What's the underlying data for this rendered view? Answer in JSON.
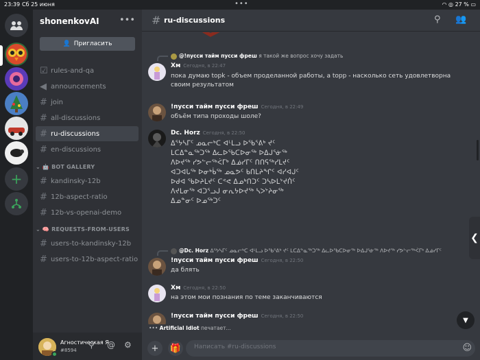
{
  "statusbar": {
    "time": "23:39",
    "date": "Сб 25 июня",
    "battery": "27 %"
  },
  "servers": [
    "Home",
    "Server 1",
    "Server 2",
    "Server 3",
    "Server 4",
    "Server 5"
  ],
  "sidebar": {
    "guild_name": "shonenkovAI",
    "invite_label": "Пригласить",
    "channels": [
      {
        "name": "rules-and-qa",
        "icon": "checkbox-icon"
      },
      {
        "name": "announcements",
        "icon": "megaphone-icon"
      },
      {
        "name": "join",
        "icon": "hash-icon"
      },
      {
        "name": "all-discussions",
        "icon": "hash-icon"
      },
      {
        "name": "ru-discussions",
        "icon": "hash-icon"
      },
      {
        "name": "en-discussions",
        "icon": "hash-icon"
      }
    ],
    "categories": [
      {
        "label": "BOT GALLERY",
        "channels": [
          "kandinsky-12b",
          "12b-aspect-ratio",
          "12b-vs-openai-demo"
        ]
      },
      {
        "label": "REQUESTS-FROM-USERS",
        "channels": [
          "users-to-kandinsky-12b",
          "users-to-12b-aspect-ratio"
        ]
      }
    ]
  },
  "user": {
    "name": "Агностическая Я...",
    "tag": "#8594"
  },
  "channel": {
    "title": "ru-discussions"
  },
  "messages": [
    {
      "reply_user": "@!пусси тайм пусси фреш",
      "reply_text": "я такой же вопрос хочу задать",
      "user": "Хм",
      "time": "Сегодня, в 22:47",
      "text": "пока думаю topk - объем проделанной работы, а topp - насколько сеть удовлетворна своим результатом"
    },
    {
      "user": "!пусси тайм пусси фреш",
      "time": "Сегодня, в 22:49",
      "text": "объём типа проходы шоле?"
    },
    {
      "user": "Dc. Horz",
      "time": "Сегодня, в 22:50",
      "text": "ᐃᕐᔭᓴᒥᑦ ᓄᓇᓕᒃᑕ ᐊᒻᒪᓗ ᐅᖃᕐᕕᒃ ᔪᑦ ᒪᑕᐃᓐᓇᖅᑐᖅ ᐃᓚᐅᖃᑕᐅᓂᖅ ᐅᐃᒍᕐᓃᖅ ᐱᐅᔪᖅ ᓯᕗᓪᓕᖅᐹᒥᒃ ᐃᓅᓯᒥᑦ ᑎᑎᕋᖅᓯᒪᔪᑦ ᐊᑐᐊᒐᖅ ᐅᓂᒃᑳᖅ ᓄᓇᕗᑦ ᑲᑎᒪᔨᖏᑦ ᐊᓯᐊᒍᑦ ᐅᑯᐊ ᖃᐅᔨᒪᔪᑦ ᑕᕝᕙ ᐃᓄᒃᑎᑐᑦ ᑐᓴᐅᒪᔾᔪᑏᑦ ᐱᔪᒪᓂᖅ ᐊᑐᕐᓗᒍ ᓂᕆᔭᐅᔪᖅ ᓴᐳᔾᔨᓂᖅ ᐃᓄᓐᓂᑦ ᐅᓄᖅᑐᑦ"
    },
    {
      "reply_user": "@Dc. Horz",
      "reply_text": "ᐃᕐᔭᓴᒥᑦ ᓄᓇᓕᒃᑕ ᐊᒻᒪᓗ ᐅᖃᕐᕕᒃ ᔪᑦ ᒪᑕᐃᓐᓇᖅᑐᖅ ᐃᓚᐅᖃᑕᐅᓂᖅ ᐅᐃᒍᕐᓃᖅ ᐱᐅᔪᖅ ᓯᕗᓪᓕᖅᐹᒥᒃ ᐃᓅᓯᒥᑦ",
      "user": "!пусси тайм пусси фреш",
      "time": "Сегодня, в 22:50",
      "text": "да блять"
    },
    {
      "user": "Хм",
      "time": "Сегодня, в 22:50",
      "text": "на этом мои познания по теме  заканчиваются"
    },
    {
      "user": "!пусси тайм пусси фреш",
      "time": "Сегодня, в 22:50",
      "text": ""
    }
  ],
  "typing": {
    "user": "Artificial Idiot",
    "text": "печатает..."
  },
  "composer": {
    "placeholder": "Написать #ru-discussions"
  }
}
